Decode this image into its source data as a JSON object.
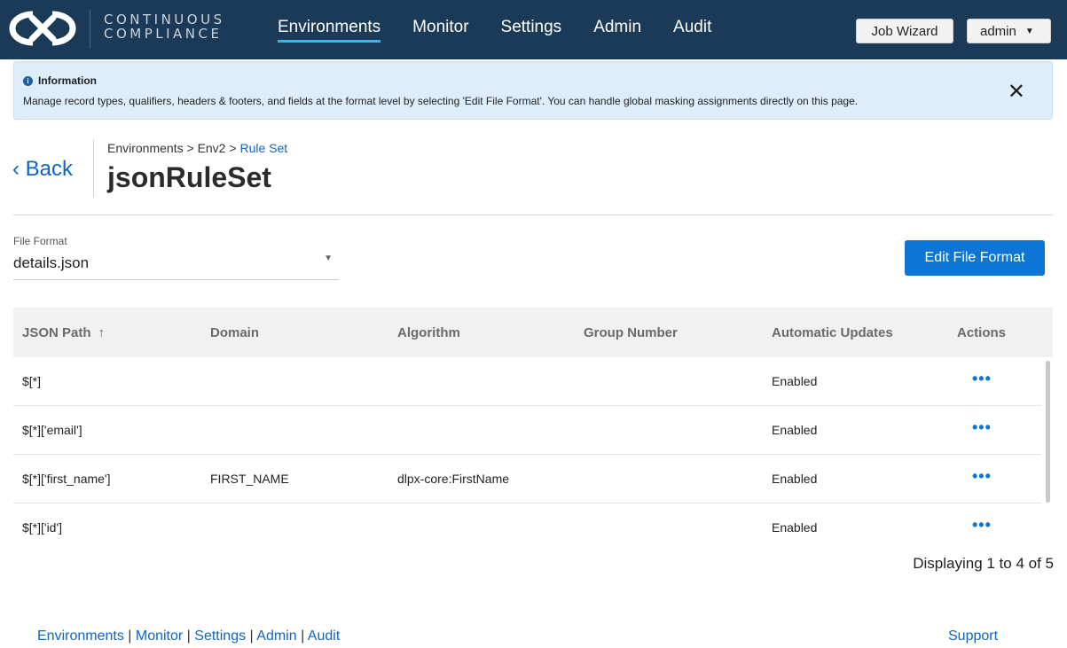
{
  "header": {
    "brand_line1": "CONTINUOUS",
    "brand_line2": "COMPLIANCE",
    "nav": [
      "Environments",
      "Monitor",
      "Settings",
      "Admin",
      "Audit"
    ],
    "active_nav": "Environments",
    "job_wizard_label": "Job Wizard",
    "user_label": "admin"
  },
  "banner": {
    "title": "Information",
    "text": "Manage record types, qualifiers, headers & footers, and fields at the format level by selecting 'Edit File Format'. You can handle global masking assignments directly on this page.",
    "close_glyph": "✕"
  },
  "page": {
    "back_label": "‹ Back",
    "breadcrumb": [
      "Environments",
      "Env2",
      "Rule Set"
    ],
    "breadcrumb_sep": " > ",
    "title": "jsonRuleSet"
  },
  "file_format": {
    "label": "File Format",
    "value": "details.json",
    "edit_label": "Edit File Format"
  },
  "table": {
    "columns": [
      "JSON Path",
      "Domain",
      "Algorithm",
      "Group Number",
      "Automatic Updates",
      "Actions"
    ],
    "sort_glyph": "↑",
    "rows": [
      {
        "json_path": "$[*]",
        "domain": "",
        "algorithm": "",
        "group_number": "",
        "automatic_updates": "Enabled"
      },
      {
        "json_path": "$[*]['email']",
        "domain": "",
        "algorithm": "",
        "group_number": "",
        "automatic_updates": "Enabled"
      },
      {
        "json_path": "$[*]['first_name']",
        "domain": "FIRST_NAME",
        "algorithm": "dlpx-core:FirstName",
        "group_number": "",
        "automatic_updates": "Enabled"
      },
      {
        "json_path": "$[*]['id']",
        "domain": "",
        "algorithm": "",
        "group_number": "",
        "automatic_updates": "Enabled"
      }
    ],
    "actions_glyph": "•••",
    "pagination": "Displaying 1 to 4 of 5"
  },
  "footer": {
    "links": [
      "Environments",
      "Monitor",
      "Settings",
      "Admin",
      "Audit"
    ],
    "separator": " | ",
    "support_label": "Support"
  },
  "colors": {
    "header_bg": "#1b3a57",
    "accent": "#0d76d4",
    "banner_bg": "#ddeefa",
    "active_underline": "#3eb4e6"
  }
}
